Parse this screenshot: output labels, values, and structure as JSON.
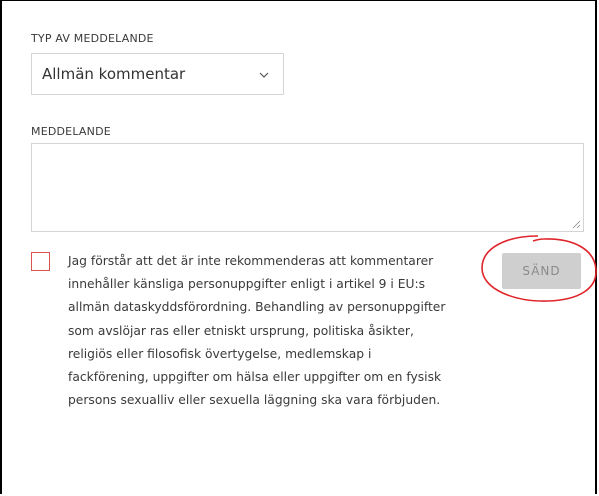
{
  "form": {
    "type_label": "TYP AV MEDDELANDE",
    "type_value": "Allmän kommentar",
    "message_label": "MEDDELANDE",
    "message_value": "",
    "consent_checked": false,
    "consent_text": "Jag förstår att det är inte rekommenderas att kommentarer innehåller känsliga personuppgifter enligt i artikel 9 i EU:s allmän dataskyddsförordning. Behandling av personuppgifter som avslöjar ras eller etniskt ursprung, politiska åsikter, religiös eller filosofisk övertygelse, medlemskap i fackförening, uppgifter om hälsa eller uppgifter om en fysisk persons sexualliv eller sexuella läggning ska vara förbjuden.",
    "send_label": "SÄND",
    "send_disabled": true
  },
  "colors": {
    "checkbox_border": "#d9534f",
    "annotation_circle": "#e0252a",
    "button_bg": "#cfcfcf",
    "button_text": "#8a8a8a"
  },
  "icons": {
    "select_arrow": "chevron-down-icon",
    "resize": "resize-grip-icon"
  }
}
